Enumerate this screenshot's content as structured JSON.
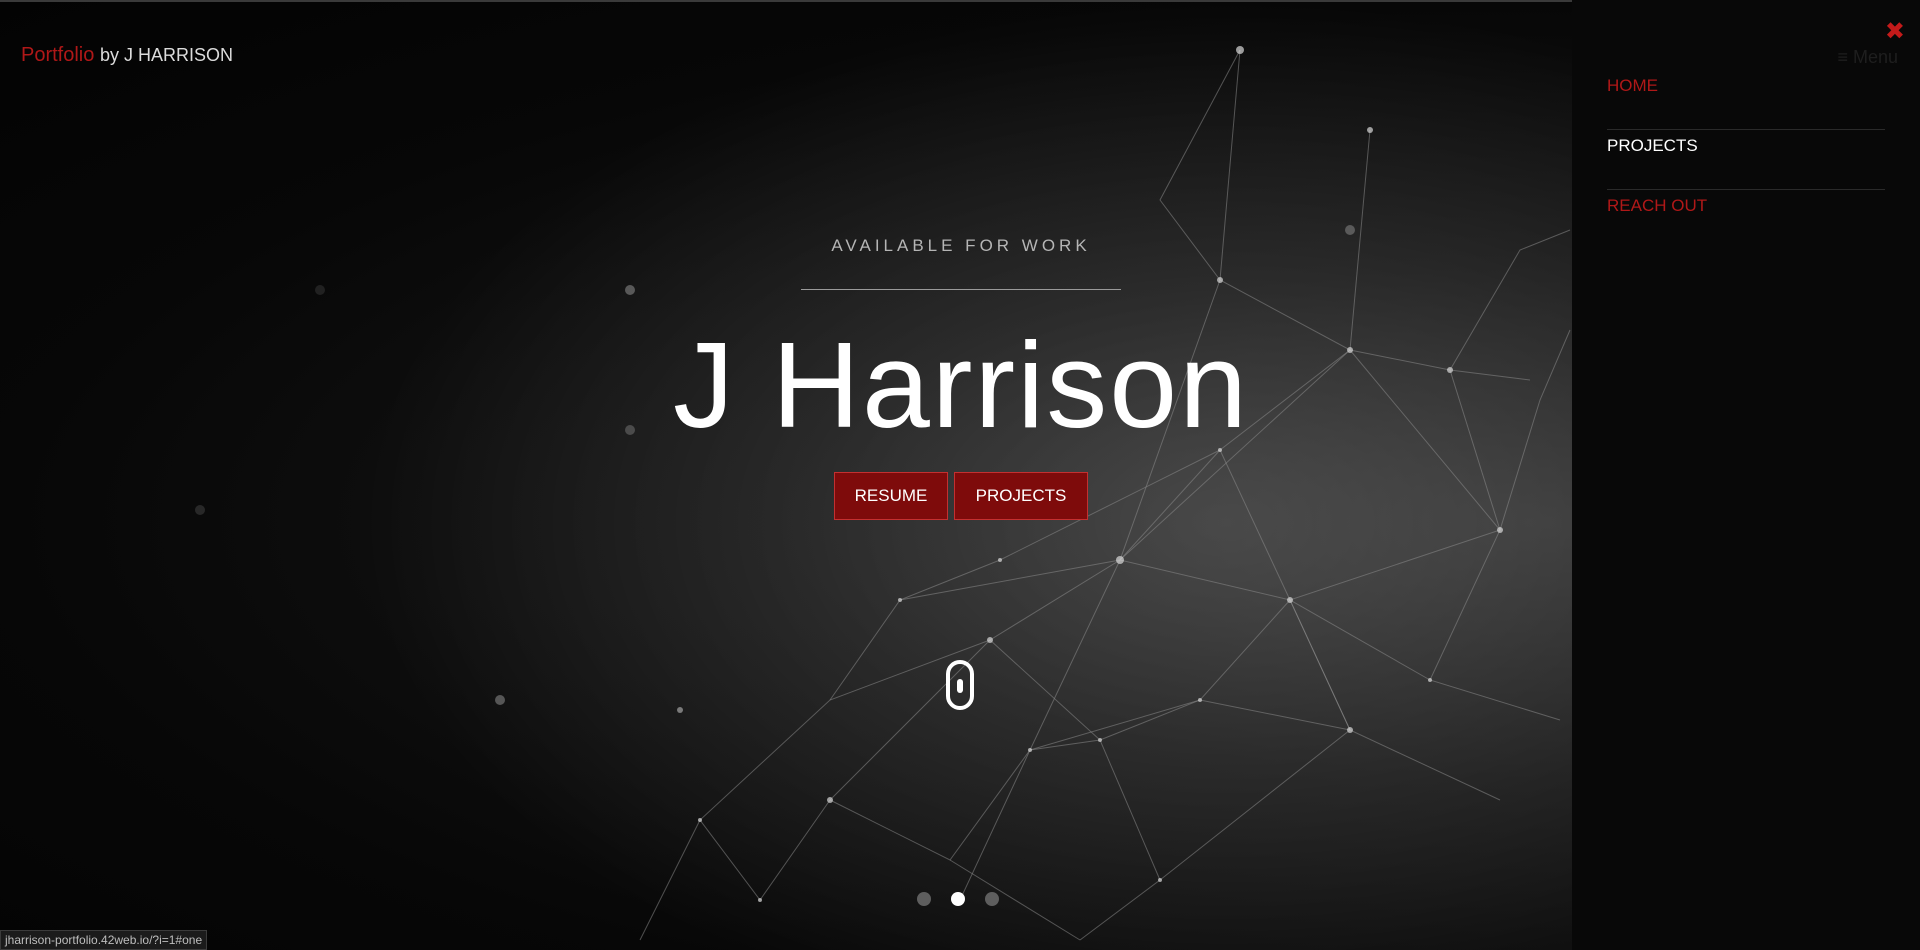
{
  "brand": {
    "accent": "Portfolio",
    "rest": "by J HARRISON"
  },
  "hero": {
    "eyebrow": "AVAILABLE FOR WORK",
    "title": "J Harrison",
    "buttons": {
      "resume": "RESUME",
      "projects": "PROJECTS"
    }
  },
  "slider": {
    "count": 3,
    "active": 2
  },
  "sidebar": {
    "close": "✖",
    "menu_label": "≡ Menu",
    "items": [
      {
        "label": "HOME",
        "state": "red"
      },
      {
        "label": "PROJECTS",
        "state": "active"
      },
      {
        "label": "REACH OUT",
        "state": "red"
      }
    ]
  },
  "status_bar": {
    "url": "jharrison-portfolio.42web.io/?i=1#one"
  },
  "colors": {
    "accent": "#b01818",
    "button_bg": "#7e0b0b",
    "background": "#050505"
  }
}
